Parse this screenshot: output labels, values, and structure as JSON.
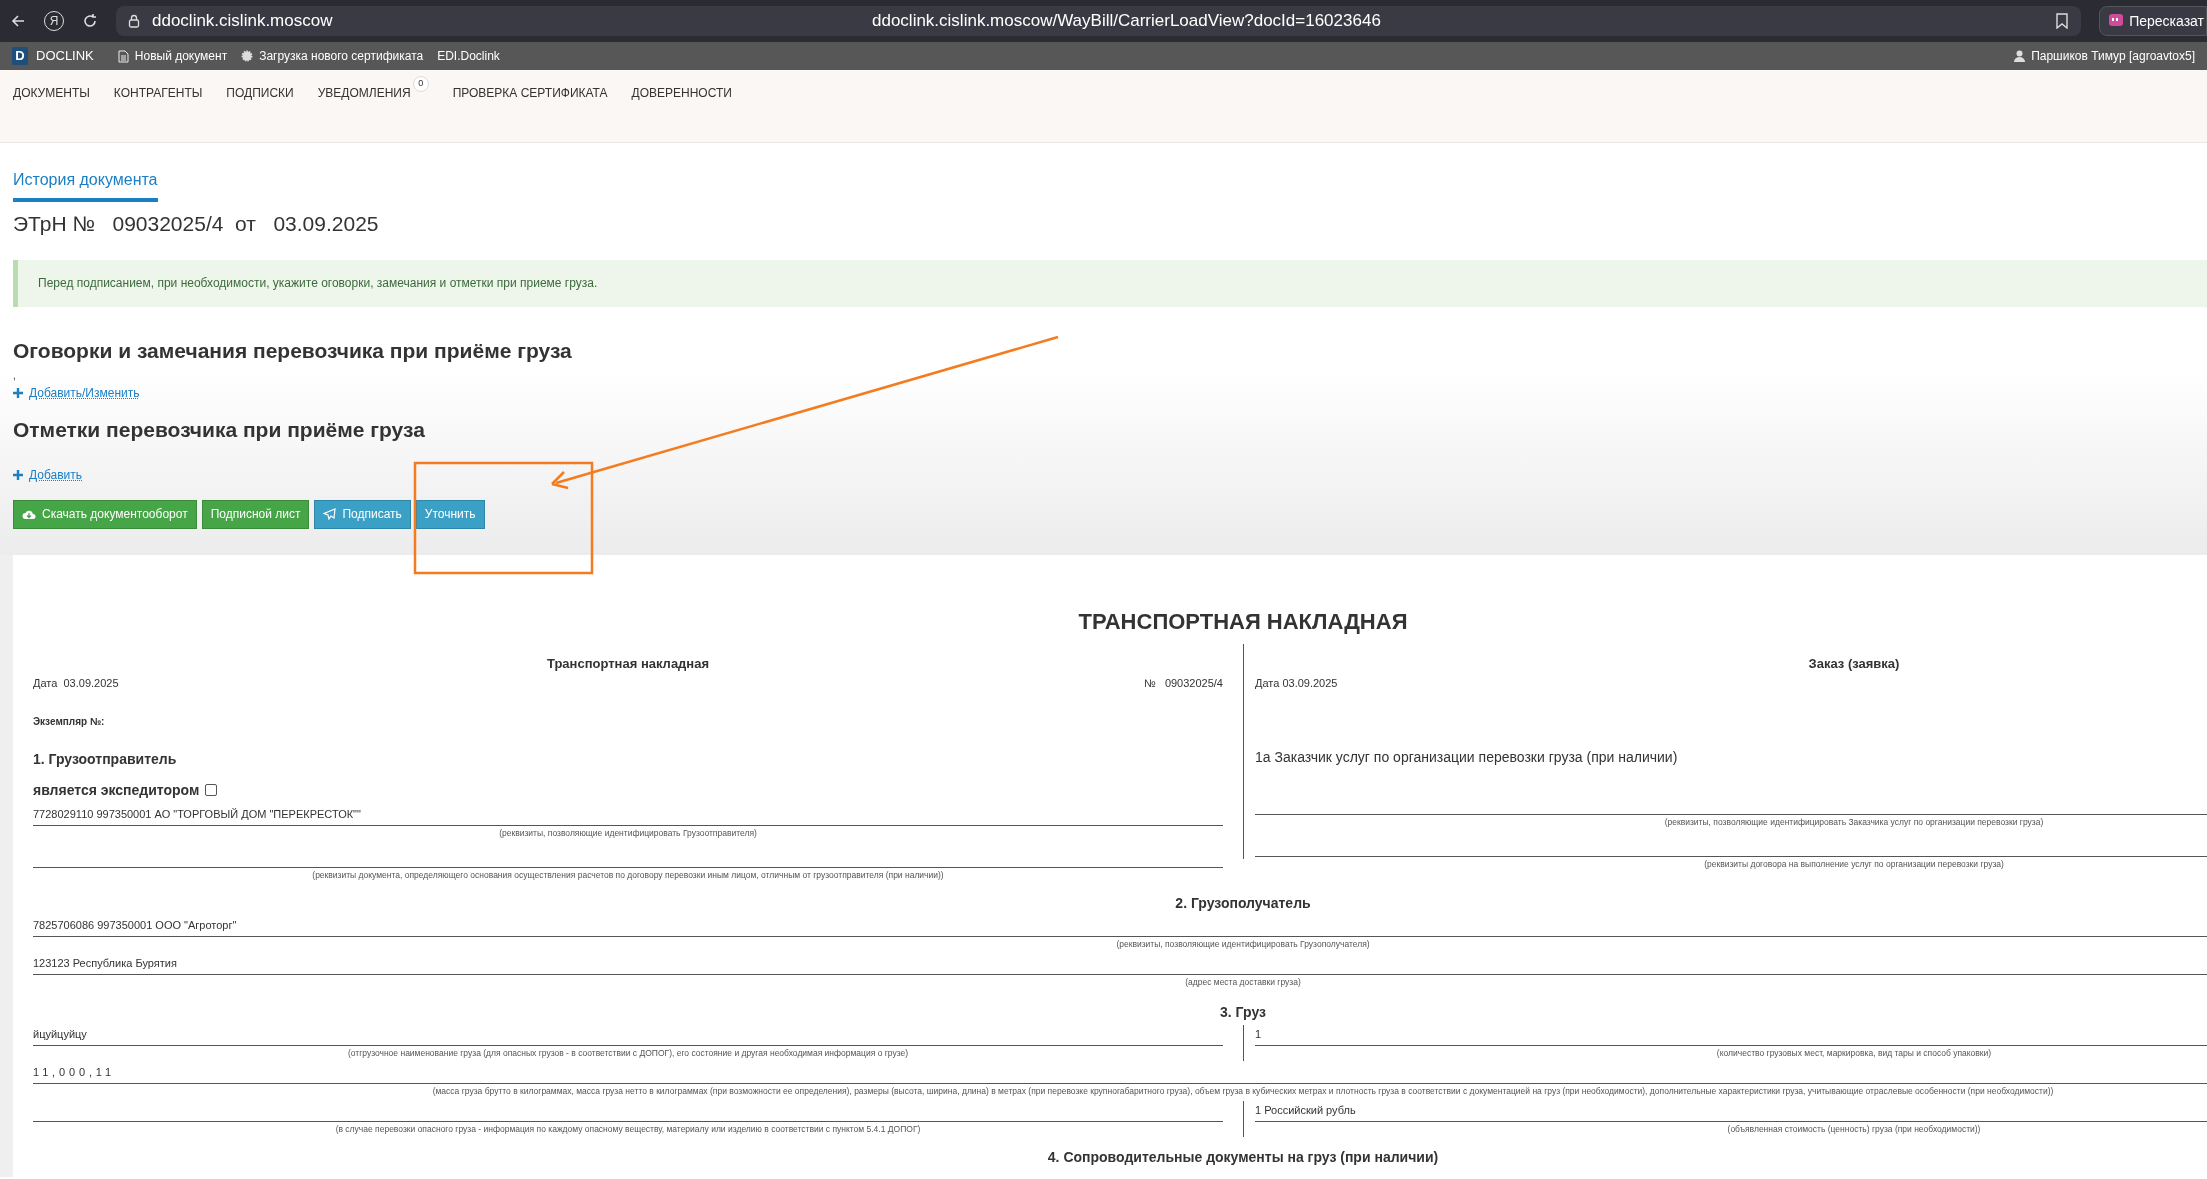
{
  "browser": {
    "yandex_glyph": "Я",
    "address_short": "ddoclink.cislink.moscow",
    "address_full": "ddoclink.cislink.moscow/WayBill/CarrierLoadView?docId=16023646",
    "retell_button": "Пересказат"
  },
  "app_bar": {
    "logo_letter": "D",
    "brand": "DOCLINK",
    "links": [
      {
        "kind": "file",
        "label": "Новый документ"
      },
      {
        "kind": "gear",
        "label": "Загрузка нового сертификата"
      },
      {
        "kind": "plain",
        "label": "EDI.Doclink"
      }
    ],
    "user": "Паршиков Тимур [agroavtox5]"
  },
  "nav": [
    {
      "label": "ДОКУМЕНТЫ"
    },
    {
      "label": "КОНТРАГЕНТЫ"
    },
    {
      "label": "ПОДПИСКИ"
    },
    {
      "label": "УВЕДОМЛЕНИЯ",
      "badge": "0"
    },
    {
      "label": "ПРОВЕРКА СЕРТИФИКАТА"
    },
    {
      "label": "ДОВЕРЕННОСТИ"
    }
  ],
  "tabs": [
    {
      "label": "История документа",
      "selected": true
    }
  ],
  "doc_title": {
    "prefix": "ЭТрН №",
    "number": "09032025/4",
    "from": "от",
    "date": "03.09.2025"
  },
  "alert": "Перед подписанием, при необходимости, укажите оговорки, замечания и отметки при приеме груза.",
  "sections": [
    {
      "heading": "Оговорки и замечания перевозчика при приёме груза",
      "note": ",",
      "link": "Добавить/Изменить"
    },
    {
      "heading": "Отметки перевозчика при приёме груза",
      "link": "Добавить"
    }
  ],
  "buttons": [
    {
      "kind": "download",
      "label": "Скачать документооборот"
    },
    {
      "kind": "success",
      "label": "Подписной лист"
    },
    {
      "kind": "send",
      "label": "Подписать"
    },
    {
      "kind": "info",
      "label": "Уточнить"
    }
  ],
  "document": {
    "title": "ТРАНСПОРТНАЯ НАКЛАДНАЯ",
    "waybill": {
      "heading": "Транспортная накладная",
      "date_label": "Дата",
      "date": "03.09.2025",
      "number_label": "№",
      "number": "09032025/4",
      "copy_label": "Экземпляр №:",
      "section": "1. Грузоотправитель",
      "forwarder_label": "является экспедитором",
      "forwarder_checked": false,
      "lines": [
        {
          "value": "7728029110 997350001 АО \"ТОРГОВЫЙ ДОМ \"ПЕРЕКРЕСТОК\"\"",
          "caption": "(реквизиты, позволяющие идентифицировать Грузоотправителя)"
        },
        {
          "caption": "(реквизиты документа, определяющего основания осуществления расчетов по договору перевозки иным лицом, отличным от грузоотправителя (при наличии))"
        }
      ]
    },
    "order": {
      "heading": "Заказ (заявка)",
      "date": "Дата 03.09.2025",
      "section": "1а Заказчик услуг по организации перевозки груза (при наличии)",
      "lines": [
        {
          "caption": "(реквизиты, позволяющие идентифицировать Заказчика услуг по организации перевозки груза)"
        },
        {
          "caption": "(реквизиты договора на выполнение услуг по организации перевозки груза)"
        }
      ]
    },
    "consignee": {
      "heading": "2. Грузополучатель",
      "lines": [
        {
          "value": "7825706086 997350001 ООО \"Агроторг\"",
          "caption": "(реквизиты, позволяющие идентифицировать Грузополучателя)"
        },
        {
          "value": "123123 Республика Бурятия",
          "caption": "(адрес места доставки груза)"
        }
      ]
    },
    "cargo": {
      "heading": "3. Груз",
      "rows": [
        {
          "kind": "split",
          "left": {
            "value": "йцуйцуйцу",
            "caption": "(отгрузочное наименование груза (для опасных грузов - в соответствии с ДОПОГ), его состояние и другая необходимая информация о грузе)"
          },
          "right": {
            "value": "1",
            "caption": "(количество грузовых мест, маркировка, вид тары и способ упаковки)"
          }
        },
        {
          "kind": "full",
          "value": "11,000,11",
          "caption": "(масса груза брутто в килограммах, масса груза нетто в килограммах (при возможности ее определения), размеры (высота, ширина, длина) в метрах (при перевозке крупногабаритного груза), объем груза в кубических метрах и плотность груза в соответствии с документацией на груз (при необходимости), дополнительные характеристики груза, учитывающие отраслевые особенности (при необходимости))"
        },
        {
          "kind": "split",
          "left": {
            "caption": "(в случае перевозки опасного груза - информация по каждому опасному веществу, материалу или изделию в соответствии с пунктом 5.4.1 ДОПОГ)"
          },
          "right": {
            "value": "1 Российский рубль",
            "caption": "(объявленная стоимость (ценность) груза (при необходимости))"
          }
        }
      ]
    },
    "next_section": "4. Сопроводительные документы на груз (при наличии)"
  }
}
